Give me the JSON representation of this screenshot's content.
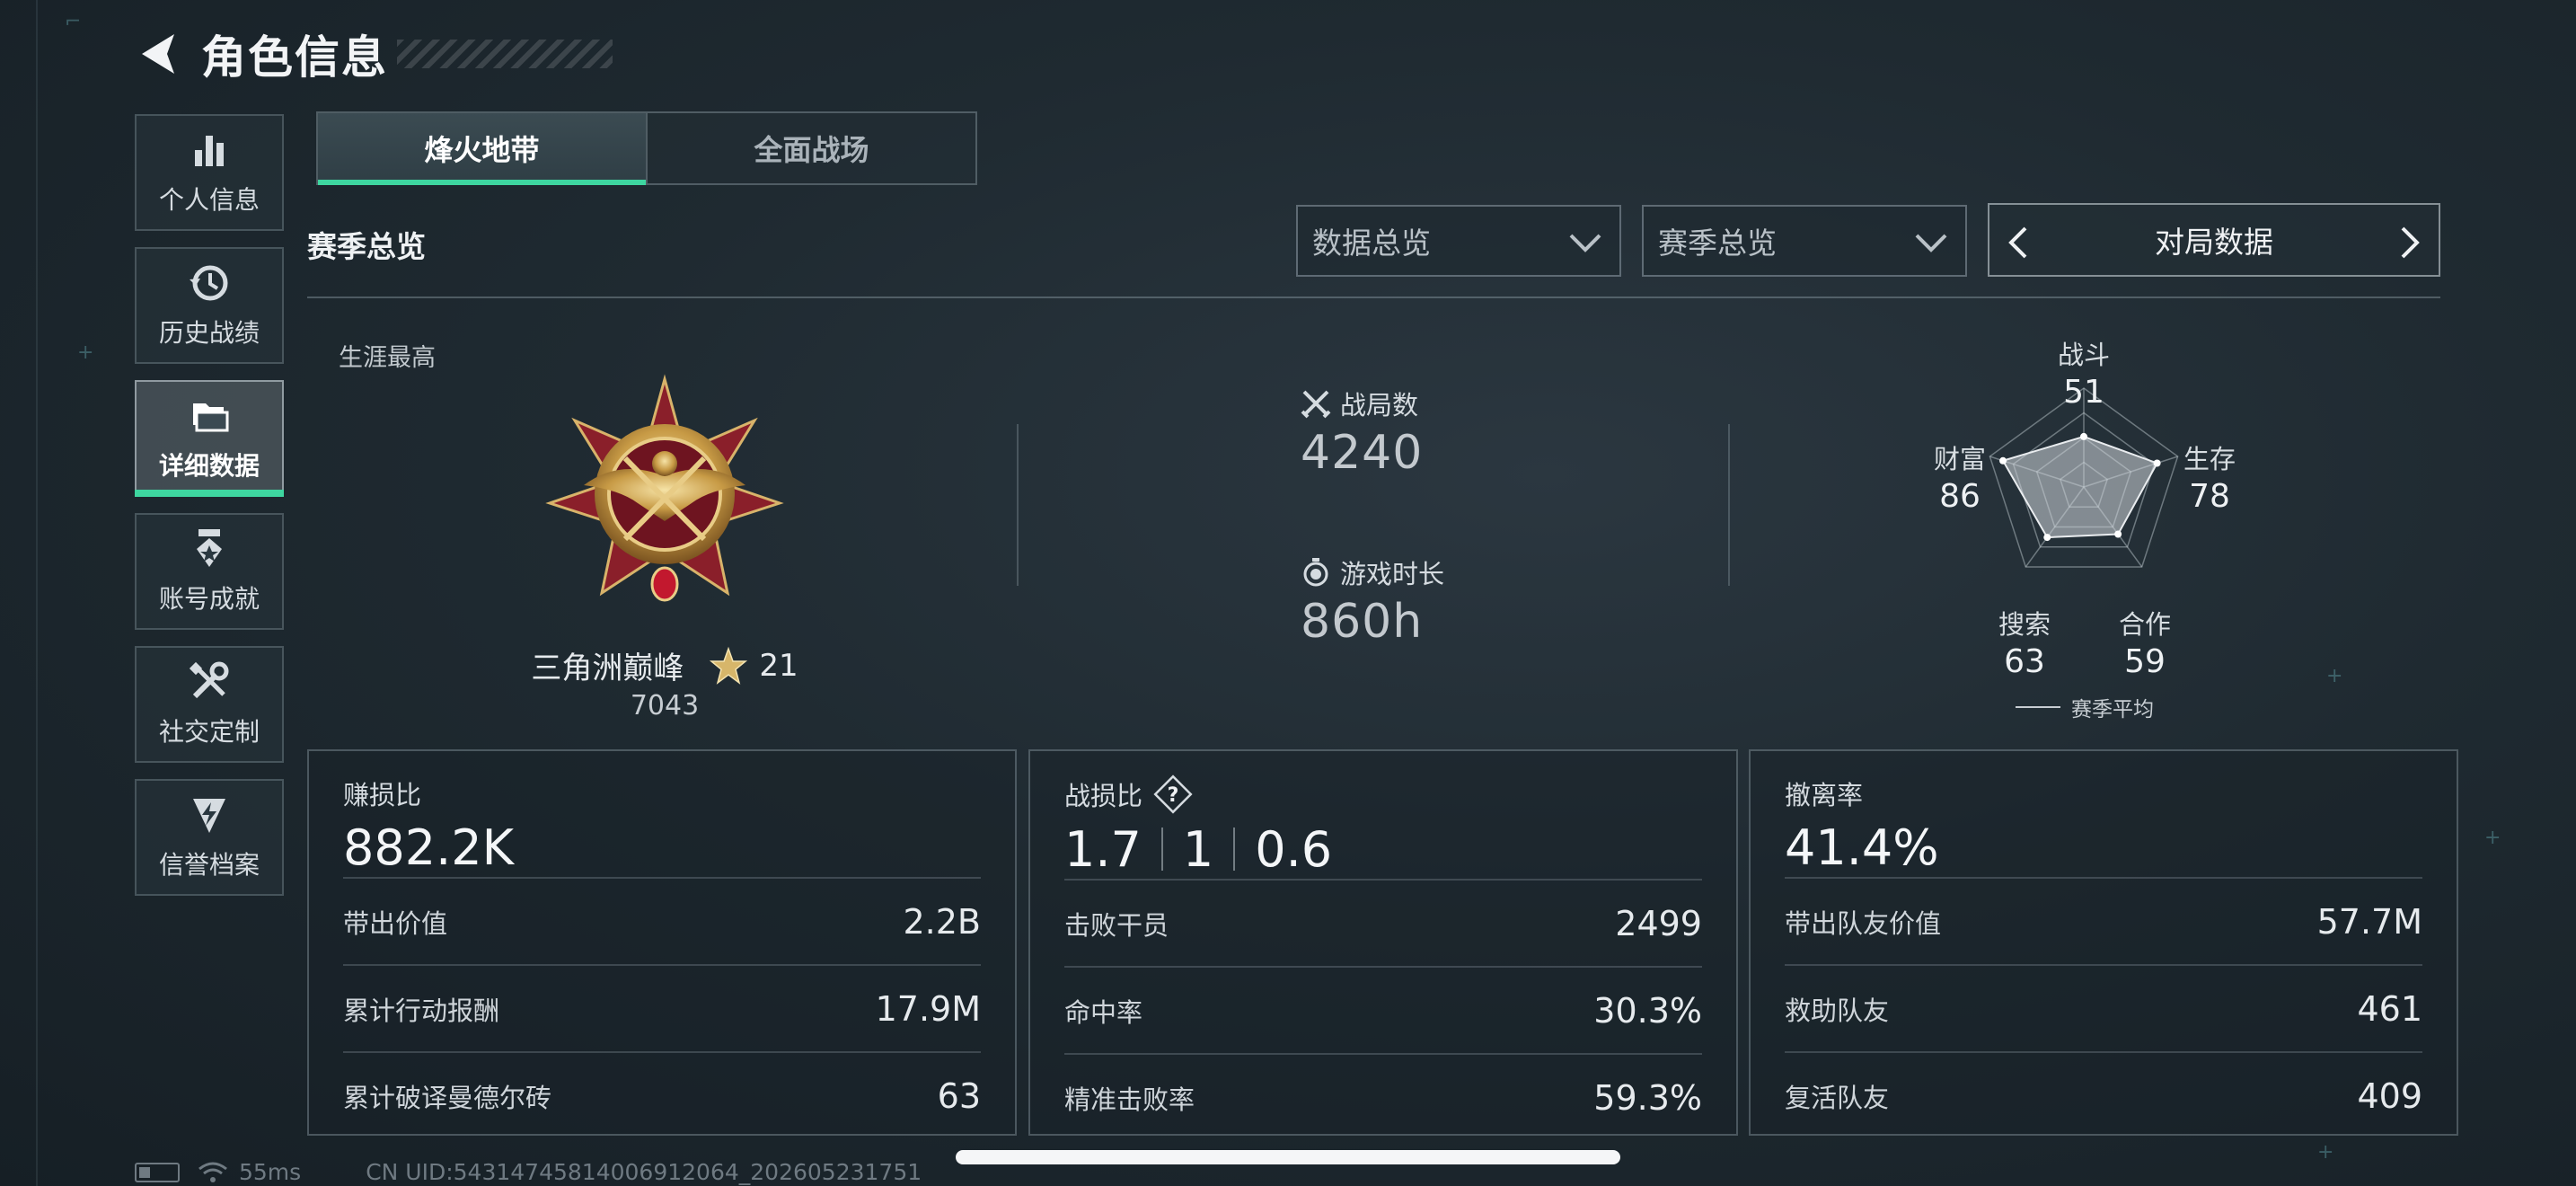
{
  "header": {
    "title": "角色信息"
  },
  "sidebar": {
    "items": [
      {
        "label": "个人信息",
        "icon": "bar-chart-icon",
        "active": false
      },
      {
        "label": "历史战绩",
        "icon": "history-clock-icon",
        "active": false
      },
      {
        "label": "详细数据",
        "icon": "folder-stack-icon",
        "active": true
      },
      {
        "label": "账号成就",
        "icon": "medal-icon",
        "active": false
      },
      {
        "label": "社交定制",
        "icon": "tools-icon",
        "active": false
      },
      {
        "label": "信誉档案",
        "icon": "shield-bolt-icon",
        "active": false
      }
    ]
  },
  "tabs": [
    {
      "label": "烽火地带",
      "active": true
    },
    {
      "label": "全面战场",
      "active": false
    }
  ],
  "section": {
    "title": "赛季总览"
  },
  "filters": {
    "data_select": "数据总览",
    "season_select": "赛季总览",
    "pager_label": "对局数据"
  },
  "career": {
    "label": "生涯最高",
    "rank_name": "三角洲巅峰",
    "stars": "21",
    "points": "7043"
  },
  "stats": {
    "matches_label": "战局数",
    "matches_value": "4240",
    "playtime_label": "游戏时长",
    "playtime_value": "860h"
  },
  "radar": {
    "axes": [
      {
        "name": "战斗",
        "value": 51
      },
      {
        "name": "生存",
        "value": 78
      },
      {
        "name": "合作",
        "value": 59
      },
      {
        "name": "搜索",
        "value": 63
      },
      {
        "name": "财富",
        "value": 86
      }
    ],
    "legend": "赛季平均"
  },
  "cards": {
    "profit": {
      "title": "赚损比",
      "big": "882.2K",
      "rows": [
        {
          "k": "带出价值",
          "v": "2.2B"
        },
        {
          "k": "累计行动报酬",
          "v": "17.9M"
        },
        {
          "k": "累计破译曼德尔砖",
          "v": "63"
        }
      ]
    },
    "combat": {
      "title": "战损比",
      "big": [
        "1.7",
        "1",
        "0.6"
      ],
      "rows": [
        {
          "k": "击败干员",
          "v": "2499"
        },
        {
          "k": "命中率",
          "v": "30.3%"
        },
        {
          "k": "精准击败率",
          "v": "59.3%"
        }
      ]
    },
    "extract": {
      "title": "撤离率",
      "big": "41.4%",
      "rows": [
        {
          "k": "带出队友价值",
          "v": "57.7M"
        },
        {
          "k": "救助队友",
          "v": "461"
        },
        {
          "k": "复活队友",
          "v": "409"
        }
      ]
    }
  },
  "footer": {
    "ping": "55ms",
    "uid": "CN UID:54314745814006912064_202605231751"
  },
  "colors": {
    "accent": "#3ed6a0",
    "background": "#1f2a31"
  }
}
